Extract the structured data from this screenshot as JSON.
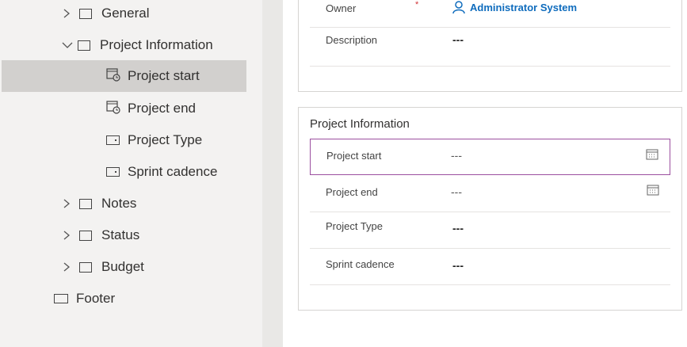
{
  "tree": {
    "general": "General",
    "project_information": "Project Information",
    "project_start": "Project start",
    "project_end": "Project end",
    "project_type": "Project Type",
    "sprint_cadence": "Sprint cadence",
    "notes": "Notes",
    "status": "Status",
    "budget": "Budget",
    "footer": "Footer"
  },
  "form": {
    "owner_label": "Owner",
    "required_mark": "*",
    "owner_value": "Administrator System",
    "description_label": "Description",
    "description_value": "---",
    "section_title": "Project Information",
    "fields": [
      {
        "label": "Project start",
        "value": "---"
      },
      {
        "label": "Project end",
        "value": "---"
      },
      {
        "label": "Project Type",
        "value": "---"
      },
      {
        "label": "Sprint cadence",
        "value": "---"
      }
    ]
  },
  "colors": {
    "accent": "#0f6cbd",
    "selected_border": "#9b4f9f",
    "required": "#d13438"
  }
}
